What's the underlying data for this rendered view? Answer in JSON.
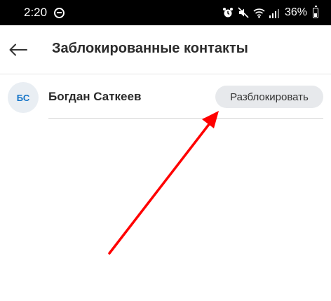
{
  "status_bar": {
    "time": "2:20",
    "battery_percent": "36%",
    "icons": [
      "do-not-disturb-icon",
      "alarm-icon",
      "mute-icon",
      "wifi-icon",
      "signal-icon",
      "battery-icon"
    ]
  },
  "header": {
    "title": "Заблокированные контакты",
    "back_icon": "arrow-left-icon"
  },
  "contacts": [
    {
      "initials": "БС",
      "name": "Богдан Саткеев",
      "action_label": "Разблокировать"
    }
  ],
  "colors": {
    "status_bar_bg": "#000000",
    "avatar_bg": "#e9eef3",
    "avatar_text": "#1273c7",
    "button_bg": "#e7e9ec",
    "annotation_arrow": "#ff0000"
  }
}
